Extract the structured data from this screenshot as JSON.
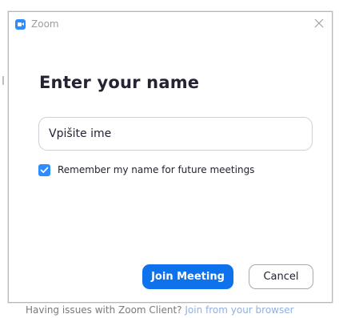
{
  "window": {
    "title": "Zoom"
  },
  "dialog": {
    "heading": "Enter your name",
    "name_input": {
      "value": "Vpišite ime",
      "placeholder": ""
    },
    "remember": {
      "checked": true,
      "label": "Remember my name for future meetings"
    },
    "buttons": {
      "join_label": "Join Meeting",
      "cancel_label": "Cancel"
    }
  },
  "background": {
    "footer_prefix": "Having issues with Zoom Client?",
    "footer_link": "Join from your browser"
  },
  "colors": {
    "accent": "#0e72ed",
    "checkbox": "#2d8cff",
    "heading_text": "#232333"
  }
}
